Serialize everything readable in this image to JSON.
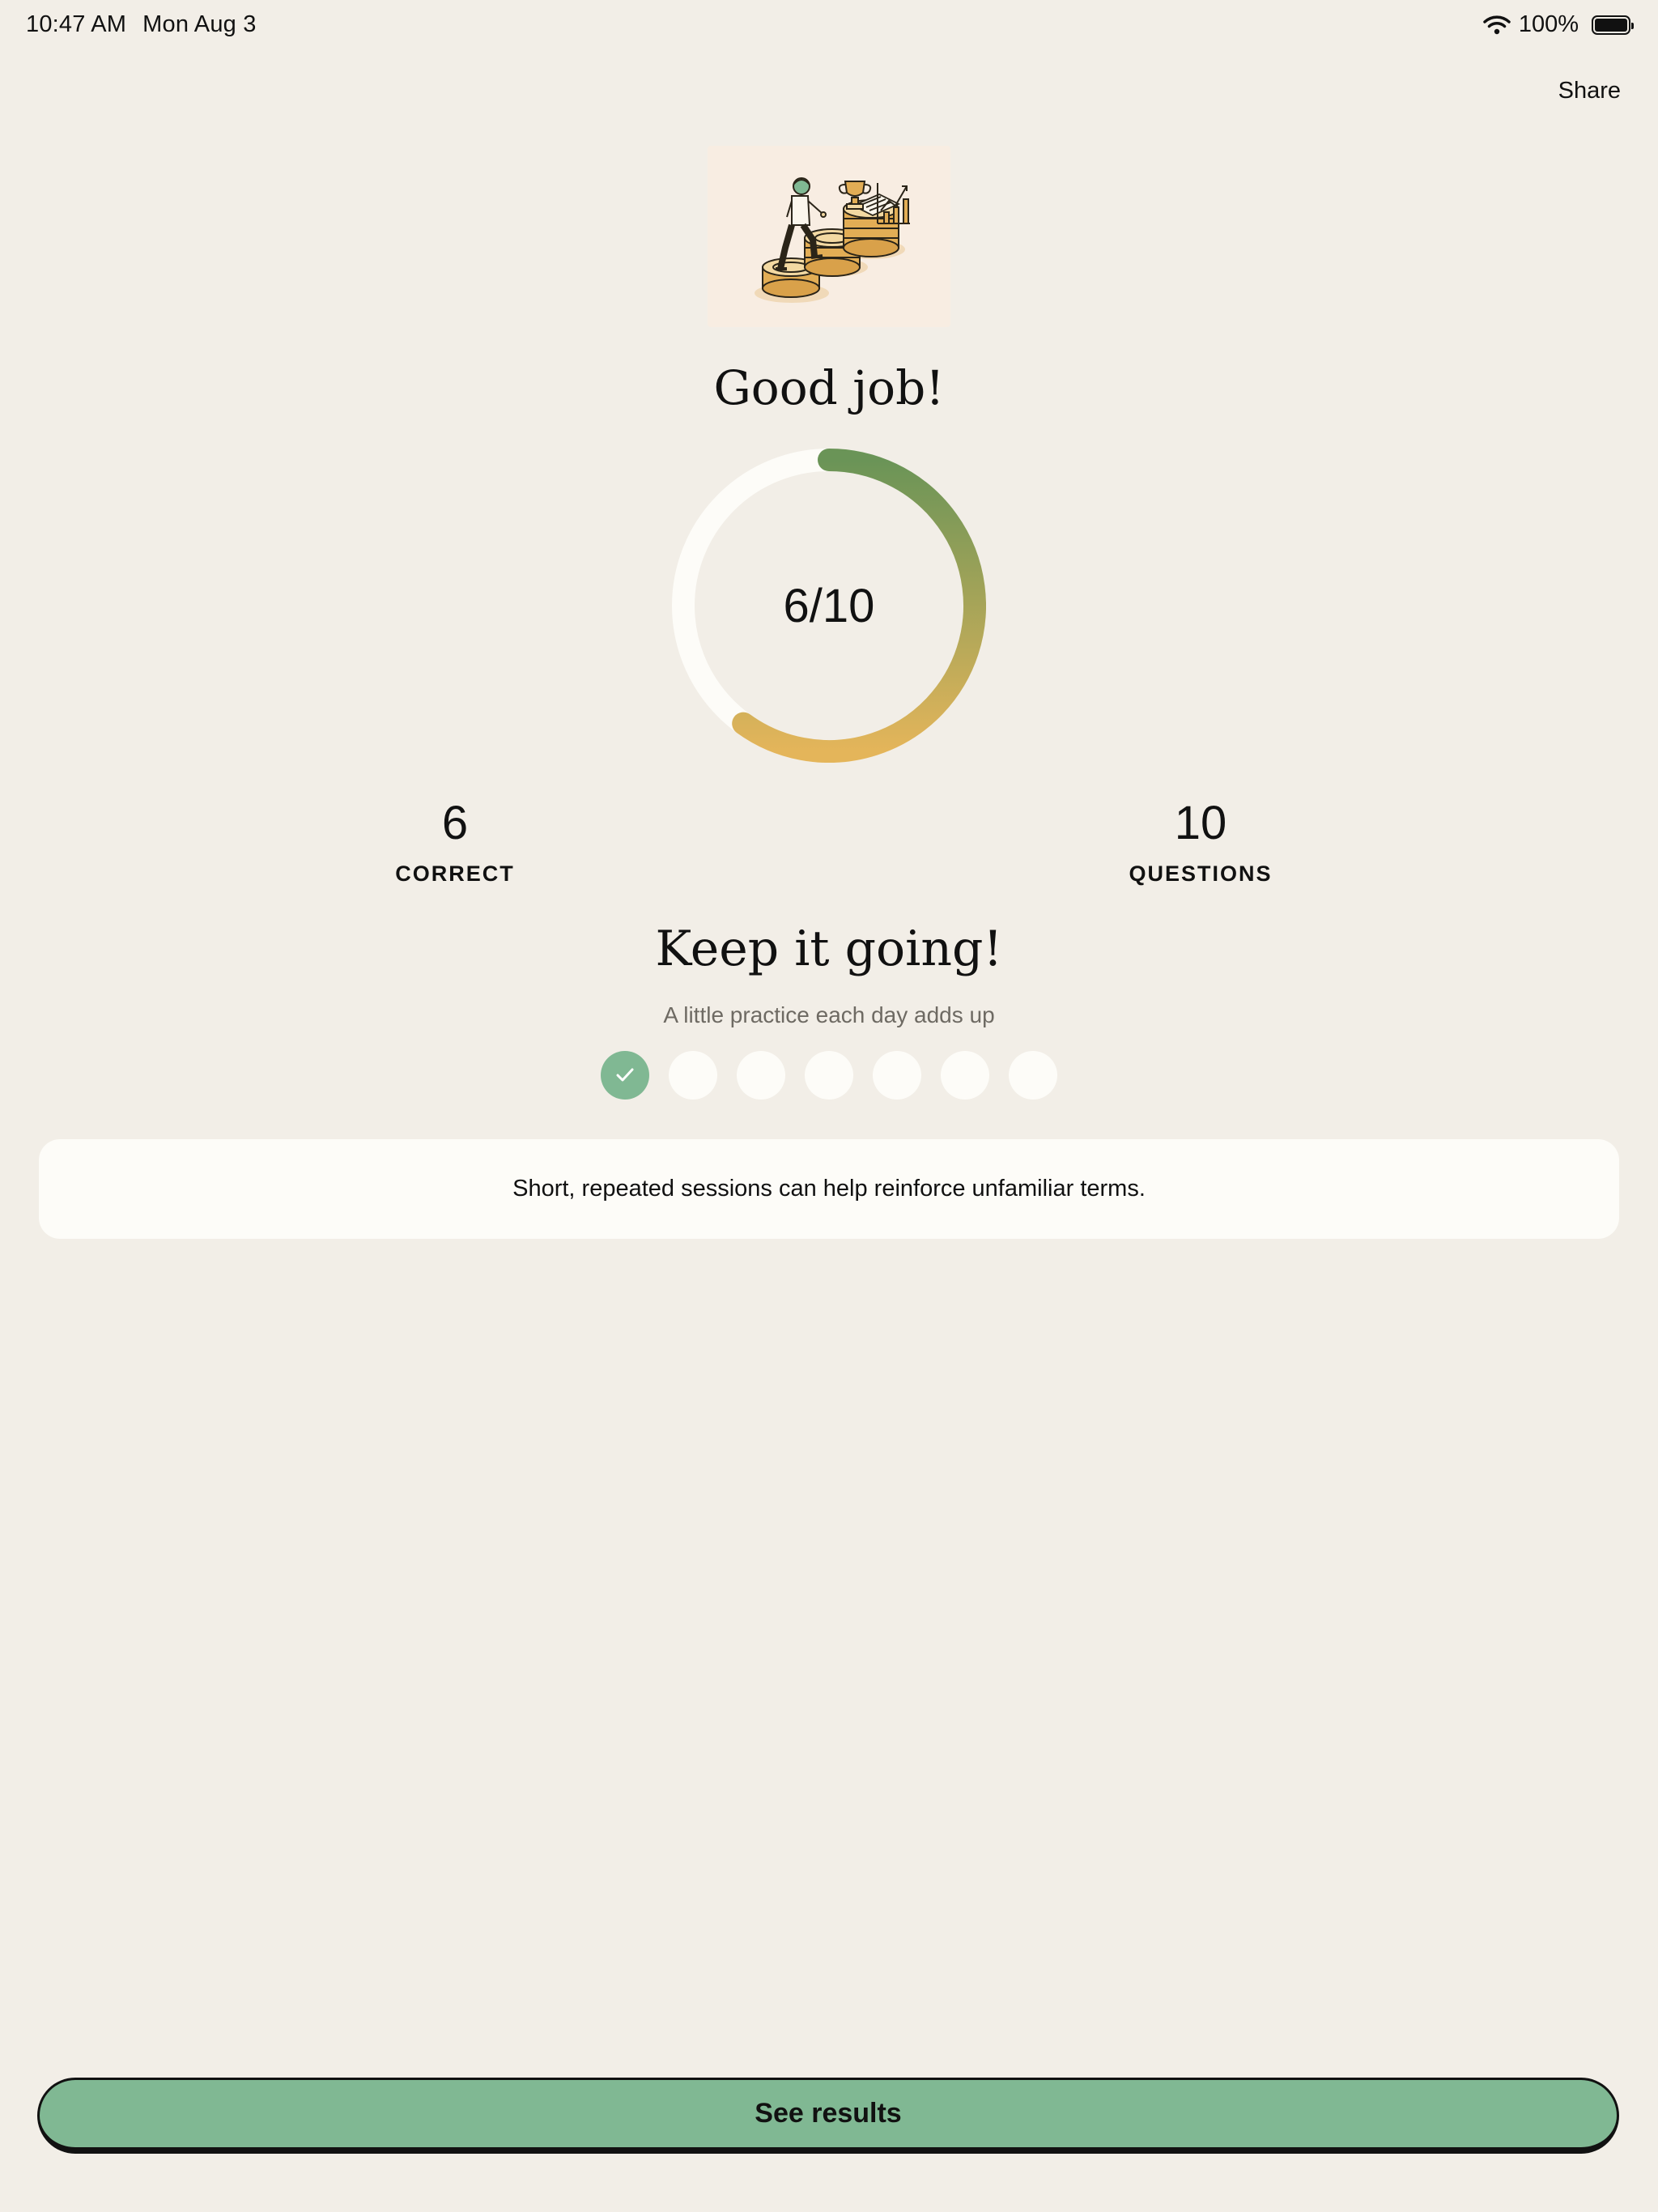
{
  "status_bar": {
    "time": "10:47 AM",
    "date": "Mon Aug 3",
    "battery": "100%",
    "wifi_icon": "wifi-icon",
    "battery_icon": "battery-icon"
  },
  "header": {
    "share_label": "Share"
  },
  "illustration": {
    "icon": "coins-staircase-illustration"
  },
  "result": {
    "headline": "Good job!",
    "score": "6/10",
    "score_fraction": 0.6,
    "ring_colors": [
      "#6a9457",
      "#e4b55a"
    ],
    "correct_value": "6",
    "correct_label": "CORRECT",
    "questions_value": "10",
    "questions_label": "QUESTIONS"
  },
  "streak": {
    "title": "Keep it going!",
    "subtitle": "A little practice each day adds up",
    "days_completed": 1,
    "days_total": 7
  },
  "tip": {
    "text": "Short, repeated sessions can help reinforce unfamiliar terms."
  },
  "footer": {
    "button_label": "See results",
    "button_color": "#80b893"
  }
}
